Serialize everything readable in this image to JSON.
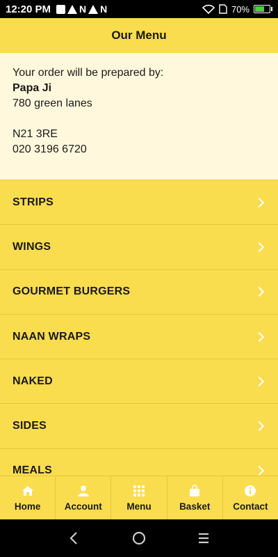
{
  "status_bar": {
    "time": "12:20 PM",
    "battery": "70%",
    "battery_level": 0.7
  },
  "header": {
    "title": "Our Menu"
  },
  "restaurant": {
    "intro": "Your order will be prepared by:",
    "name": "Papa Ji",
    "address_line1": "780 green lanes",
    "postcode": "N21 3RE",
    "phone": "020 3196 6720"
  },
  "menu": {
    "items": [
      {
        "label": "STRIPS"
      },
      {
        "label": "WINGS"
      },
      {
        "label": "GOURMET BURGERS"
      },
      {
        "label": "NAAN WRAPS"
      },
      {
        "label": "NAKED"
      },
      {
        "label": "SIDES"
      },
      {
        "label": "MEALS"
      }
    ]
  },
  "tabbar": {
    "tabs": [
      {
        "label": "Home",
        "icon": "home-icon"
      },
      {
        "label": "Account",
        "icon": "person-icon"
      },
      {
        "label": "Menu",
        "icon": "grid-icon"
      },
      {
        "label": "Basket",
        "icon": "shopping-bag-icon"
      },
      {
        "label": "Contact",
        "icon": "info-icon"
      }
    ]
  },
  "colors": {
    "primary": "#FADC4F",
    "info_bg": "#FFF8DC",
    "text": "#1a1a1a"
  }
}
